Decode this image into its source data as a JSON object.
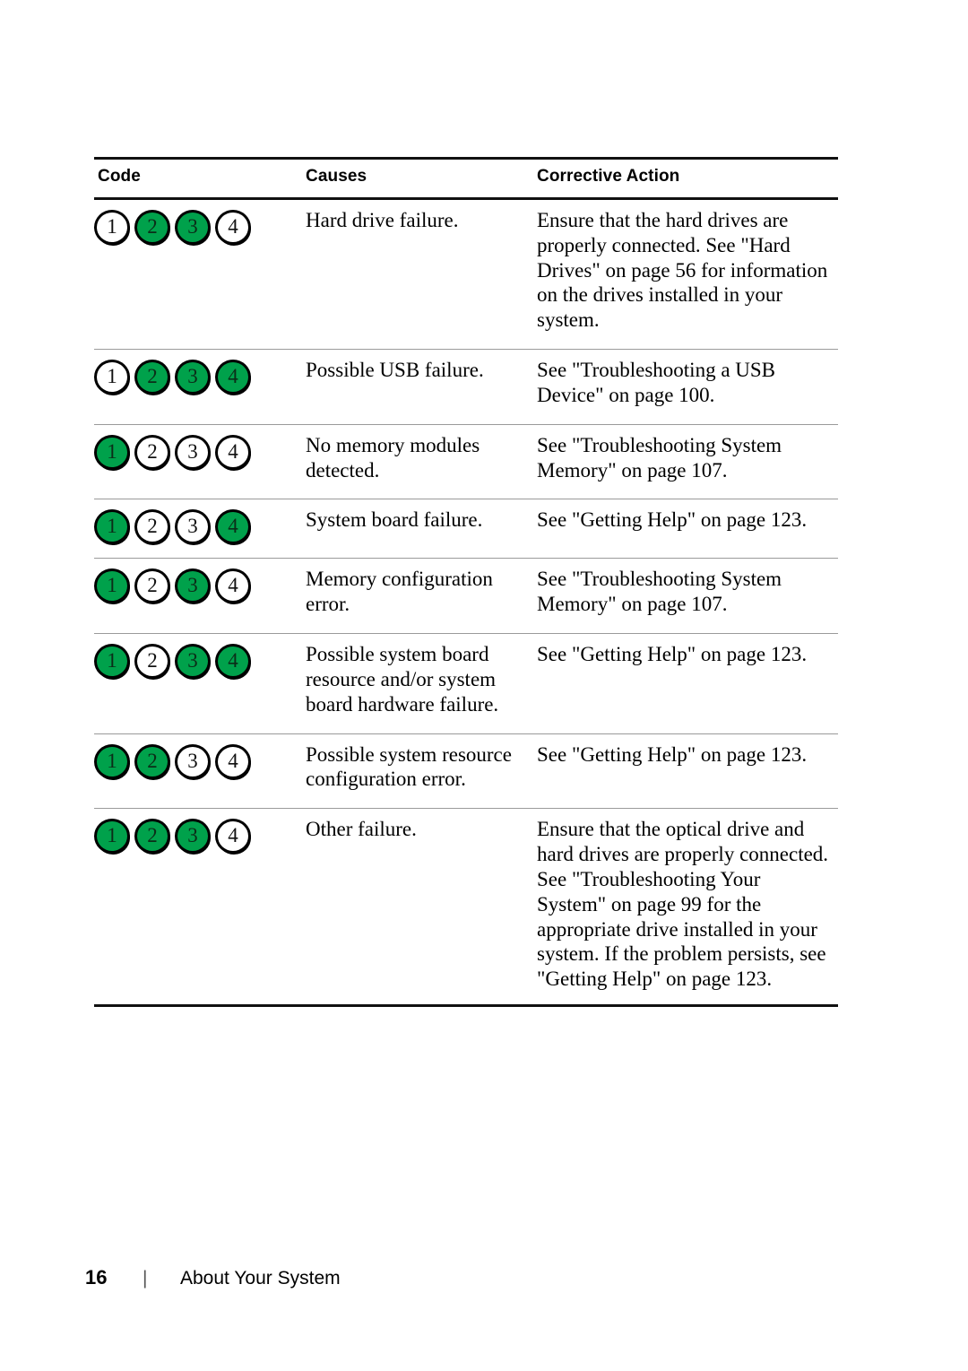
{
  "document": {
    "footer": {
      "page_number": "16",
      "separator": "|",
      "section_title": "About Your System"
    }
  },
  "colors": {
    "led_on": "#00a14b",
    "led_off": "#ffffff",
    "led_ring": "#000000",
    "rule_heavy": "#111111",
    "rule_light": "#9a9a9a"
  },
  "table": {
    "headers": {
      "code": "Code",
      "causes": "Causes",
      "corrective_action": "Corrective Action"
    },
    "led_labels": [
      "1",
      "2",
      "3",
      "4"
    ],
    "rows": [
      {
        "code_leds": [
          false,
          true,
          true,
          false
        ],
        "cause": "Hard drive failure.",
        "action": "Ensure that the hard drives are properly connected. See \"Hard Drives\" on page 56 for information on the drives installed in your system."
      },
      {
        "code_leds": [
          false,
          true,
          true,
          true
        ],
        "cause": "Possible USB failure.",
        "action": "See \"Troubleshooting a USB Device\" on page 100."
      },
      {
        "code_leds": [
          true,
          false,
          false,
          false
        ],
        "cause": "No memory modules detected.",
        "action": "See \"Troubleshooting System Memory\" on page 107."
      },
      {
        "code_leds": [
          true,
          false,
          false,
          true
        ],
        "cause": "System board failure.",
        "action": "See \"Getting Help\" on page 123."
      },
      {
        "code_leds": [
          true,
          false,
          true,
          false
        ],
        "cause": "Memory configuration error.",
        "action": "See \"Troubleshooting System Memory\" on page 107."
      },
      {
        "code_leds": [
          true,
          false,
          true,
          true
        ],
        "cause": "Possible system board resource and/or system board hardware failure.",
        "action": "See \"Getting Help\" on page 123."
      },
      {
        "code_leds": [
          true,
          true,
          false,
          false
        ],
        "cause": "Possible system resource configuration error.",
        "action": "See \"Getting Help\" on page 123."
      },
      {
        "code_leds": [
          true,
          true,
          true,
          false
        ],
        "cause": "Other failure.",
        "action": "Ensure that the optical drive and hard drives are properly connected. See \"Troubleshooting Your System\" on page 99 for the appropriate drive installed in your system. If the problem persists, see \"Getting Help\" on page 123."
      }
    ]
  }
}
